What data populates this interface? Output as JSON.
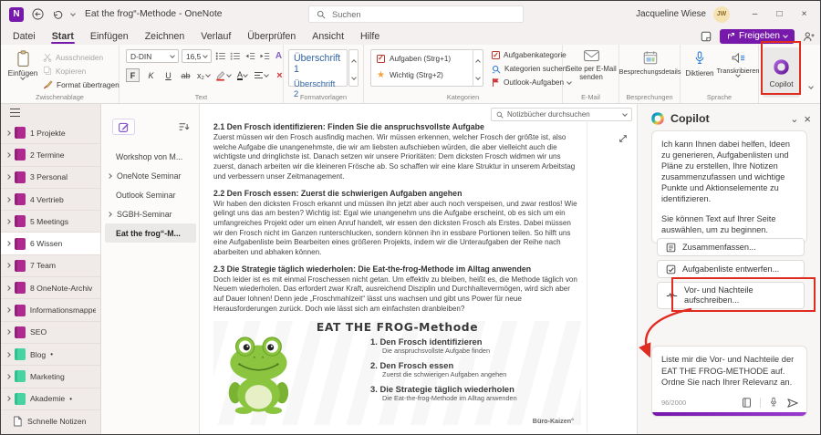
{
  "titlebar": {
    "app_initial": "N",
    "title": "Eat the frog“-Methode  -  OneNote",
    "search_placeholder": "Suchen",
    "user_name": "Jacqueline Wiese",
    "user_initials": "JW",
    "minimize": "–",
    "maximize": "□",
    "close": "×"
  },
  "menubar": {
    "items": [
      "Datei",
      "Start",
      "Einfügen",
      "Zeichnen",
      "Verlauf",
      "Überprüfen",
      "Ansicht",
      "Hilfe"
    ],
    "active": "Start",
    "share_label": "Freigeben"
  },
  "ribbon": {
    "paste": "Einfügen",
    "cut": "Ausschneiden",
    "copy": "Kopieren",
    "format_painter": "Format übertragen",
    "group_clipboard": "Zwischenablage",
    "font_name": "D-DIN",
    "font_size": "16,5",
    "bold": "F",
    "italic": "K",
    "underline": "U",
    "strikethrough": "ab",
    "subscript": "x₂",
    "ink_to_text": "A",
    "font_color_letter": "A",
    "delete_glyph": "×",
    "group_text": "Text",
    "style_1": "Überschrift 1",
    "style_2": "Überschrift 2",
    "group_styles": "Formatvorlagen",
    "tag_1": "Aufgaben (Strg+1)",
    "tag_2": "Wichtig (Strg+2)",
    "tag_check": "✓",
    "tag_star": "★",
    "tag_category": "Aufgabenkategorie",
    "tag_search": "Kategorien suchen",
    "outlook_tasks": "Outlook-Aufgaben",
    "group_tags": "Kategorien",
    "email_button": "Seite per E-Mail senden",
    "group_email": "E-Mail",
    "meetings_button": "Besprechungsdetails",
    "group_meetings": "Besprechungen",
    "dictate": "Diktieren",
    "transcribe": "Transkribieren",
    "group_language": "Sprache",
    "copilot": "Copilot"
  },
  "notebooks": {
    "items": [
      {
        "label": "1 Projekte",
        "suffix": ""
      },
      {
        "label": "2 Termine",
        "suffix": ""
      },
      {
        "label": "3 Personal",
        "suffix": ""
      },
      {
        "label": "4 Vertrieb",
        "suffix": ""
      },
      {
        "label": "5 Meetings",
        "suffix": ""
      },
      {
        "label": "6 Wissen",
        "suffix": ""
      },
      {
        "label": "7 Team",
        "suffix": ""
      },
      {
        "label": "8 OneNote-Archiv",
        "suffix": ""
      },
      {
        "label": "Informationsmappe...",
        "suffix": ""
      },
      {
        "label": "SEO",
        "suffix": ""
      },
      {
        "label": "Blog",
        "suffix": "•"
      },
      {
        "label": "Marketing",
        "suffix": ""
      },
      {
        "label": "Akademie",
        "suffix": "•"
      }
    ],
    "selected": "6 Wissen",
    "quick_notes": "Schnelle Notizen"
  },
  "pages": {
    "items": [
      {
        "label": "Workshop von M..."
      },
      {
        "label": "OneNote Seminar"
      },
      {
        "label": "Outlook Seminar"
      },
      {
        "label": "SGBH-Seminar"
      },
      {
        "label": "Eat the frog“-M..."
      }
    ],
    "selected": "Eat the frog“-M..."
  },
  "content": {
    "search_placeholder": "Notizbücher durchsuchen",
    "sections": [
      {
        "heading": "2.1 Den Frosch identifizieren: Finden Sie die anspruchsvollste Aufgabe",
        "body": "Zuerst müssen wir den Frosch ausfindig machen. Wir müssen erkennen, welcher Frosch der größte ist, also welche Aufgabe die unangenehmste, die wir am liebsten aufschieben würden, die aber vielleicht auch die wichtigste und dringlichste ist. Danach setzen wir unsere Prioritäten: Dem dicksten Frosch widmen wir uns zuerst, danach arbeiten wir die kleineren Frösche ab. So schaffen wir eine klare Struktur in unserem Arbeitstag und verbessern unser Zeitmanagement."
      },
      {
        "heading": "2.2 Den Frosch essen: Zuerst die schwierigen Aufgaben angehen",
        "body": "Wir haben den dicksten Frosch erkannt und müssen ihn jetzt aber auch noch verspeisen, und zwar restlos! Wie gelingt uns das am besten? Wichtig ist: Egal wie unangenehm uns die Aufgabe erscheint, ob es sich um ein umfangreiches Projekt oder um einen Anruf handelt, wir essen den dicksten Frosch als Erstes. Dabei müssen wir den Frosch nicht im Ganzen runterschlucken, sondern können ihn in essbare Portionen teilen. So hilft uns eine Aufgabenliste beim Bearbeiten eines größeren Projekts, indem wir die Unteraufgaben der Reihe nach abarbeiten und abhaken können."
      },
      {
        "heading": "2.3 Die Strategie täglich wiederholen: Die Eat-the-frog-Methode im Alltag anwenden",
        "body": "Doch leider ist es mit einmal Froschessen nicht getan. Um effektiv zu bleiben, heißt es, die Methode täglich von Neuem wiederholen. Das erfordert zwar Kraft, ausreichend Disziplin und Durchhaltevermögen, wird sich aber auf Dauer lohnen! Denn jede „Froschmahlzeit“ lässt uns wachsen und gibt uns Power für neue Herausforderungen zurück. Doch wie lässt sich am einfachsten dranbleiben?"
      }
    ],
    "infographic": {
      "title": "EAT THE FROG-Methode",
      "steps": [
        {
          "num": "1.",
          "title": "Den Frosch identifizieren",
          "subtitle": "Die anspruchsvollste Aufgabe finden"
        },
        {
          "num": "2.",
          "title": "Den Frosch essen",
          "subtitle": "Zuerst die schwierigen Aufgaben angehen"
        },
        {
          "num": "3.",
          "title": "Die Strategie täglich wiederholen",
          "subtitle": "Die Eat-the-frog-Methode im Alltag anwenden"
        }
      ],
      "credit": "Büro-Kaizen°"
    }
  },
  "copilot": {
    "title": "Copilot",
    "collapse_glyph": "⌄",
    "close_glyph": "×",
    "intro": "Ich kann Ihnen dabei helfen, Ideen zu generieren, Aufgabenlisten und Pläne zu erstellen, Ihre Notizen zusammenzufassen und wichtige Punkte und Aktionselemente zu identifizieren.",
    "hint": "Sie können Text auf Ihrer Seite auswählen, um zu beginnen.",
    "actions": [
      "Zusammenfassen...",
      "Aufgabenliste entwerfen...",
      "Vor- und Nachteile aufschreiben..."
    ],
    "prompt": "Liste mir die Vor- und Nachteile der EAT THE FROG-METHODE auf. Ordne Sie nach Ihrer Relevanz an.",
    "char_count": "96/2000"
  },
  "colors": {
    "accent_purple": "#7719aa",
    "annotation_red": "#e02b20",
    "notebook_magenta": "#ae2a8f",
    "notebook_green": "#4ad3a2",
    "heading_blue": "#3165a4"
  }
}
